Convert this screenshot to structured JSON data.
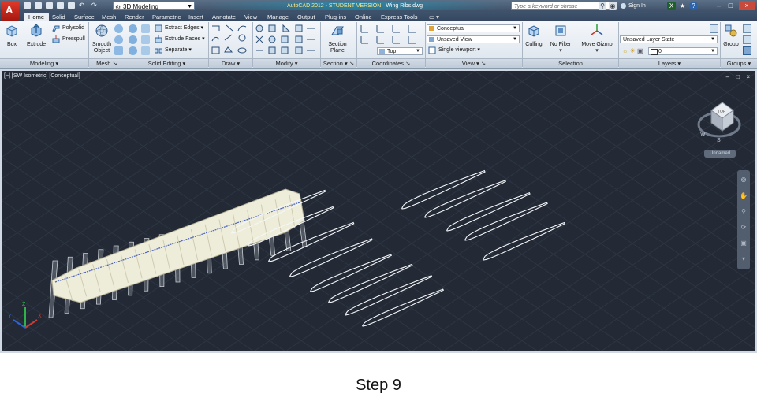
{
  "title_bar": {
    "workspace": "3D Modeling",
    "app_title": "AutoCAD 2012 - STUDENT VERSION",
    "file_name": "Wing Ribs.dwg",
    "search_placeholder": "Type a keyword or phrase",
    "sign_in": "Sign In"
  },
  "tabs": [
    "Home",
    "Solid",
    "Surface",
    "Mesh",
    "Render",
    "Parametric",
    "Insert",
    "Annotate",
    "View",
    "Manage",
    "Output",
    "Plug-ins",
    "Online",
    "Express Tools"
  ],
  "active_tab": "Home",
  "ribbon": {
    "modeling": {
      "title": "Modeling",
      "box": "Box",
      "extrude": "Extrude",
      "polysolid": "Polysolid",
      "presspull": "Presspull"
    },
    "mesh": {
      "title": "Mesh",
      "smooth_line1": "Smooth",
      "smooth_line2": "Object"
    },
    "solid_editing": {
      "title": "Solid Editing",
      "extract_edges": "Extract Edges",
      "extrude_faces": "Extrude Faces",
      "separate": "Separate"
    },
    "draw": {
      "title": "Draw"
    },
    "modify": {
      "title": "Modify"
    },
    "section": {
      "title": "Section",
      "plane_line1": "Section",
      "plane_line2": "Plane"
    },
    "coordinates": {
      "title": "Coordinates",
      "view_name": "Top"
    },
    "view": {
      "title": "View",
      "visual_style": "Conceptual",
      "named_view": "Unsaved View",
      "viewport": "Single viewport"
    },
    "selection": {
      "title": "Selection",
      "culling": "Culling",
      "no_filter": "No Filter",
      "move_gizmo": "Move Gizmo"
    },
    "layers": {
      "title": "Layers",
      "layer_state": "Unsaved Layer State",
      "current_layer": "0"
    },
    "groups": {
      "title": "Groups",
      "group": "Group"
    }
  },
  "viewport": {
    "label": "[−] [SW Isometric] [Conceptual]",
    "controls": "‒ □ ×",
    "viewcube": {
      "label": "Unnamed",
      "face": "TOP",
      "compass_w": "W",
      "compass_s": "S"
    },
    "ucs": {
      "x": "X",
      "y": "Y",
      "z": "Z"
    }
  },
  "caption": "Step 9",
  "colors": {
    "viewport_bg": "#232a36",
    "wing_fill": "#efeedd",
    "rib_outline": "#f4f6f8",
    "ribbon_bg": "#e6ecf2"
  }
}
